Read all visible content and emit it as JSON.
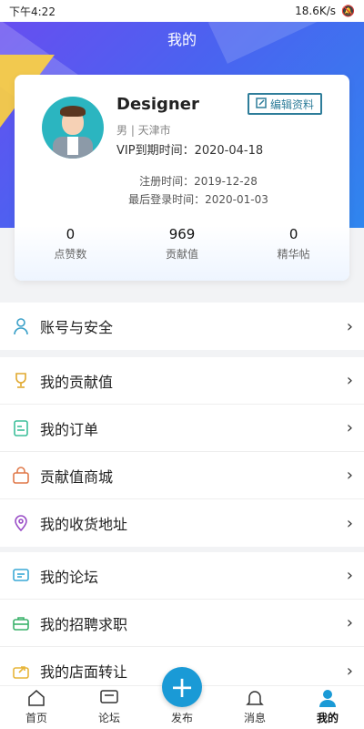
{
  "status": {
    "time": "下午4:22",
    "speed": "18.6K/s"
  },
  "page_title": "我的",
  "profile": {
    "name": "Designer",
    "gender_city": "男 | 天津市",
    "vip": "VIP到期时间：2020-04-18",
    "edit_label": "编辑资料",
    "register": "注册时间：2019-12-28",
    "last_login": "最后登录时间：2020-01-03",
    "stats": [
      {
        "value": "0",
        "label": "点赞数"
      },
      {
        "value": "969",
        "label": "贡献值"
      },
      {
        "value": "0",
        "label": "精华帖"
      }
    ]
  },
  "menu_groups": [
    [
      {
        "label": "账号与安全",
        "icon": "user-icon"
      }
    ],
    [
      {
        "label": "我的贡献值",
        "icon": "trophy-icon"
      },
      {
        "label": "我的订单",
        "icon": "order-icon"
      },
      {
        "label": "贡献值商城",
        "icon": "shop-bag-icon"
      },
      {
        "label": "我的收货地址",
        "icon": "location-icon"
      }
    ],
    [
      {
        "label": "我的论坛",
        "icon": "chat-icon"
      },
      {
        "label": "我的招聘求职",
        "icon": "briefcase-icon"
      },
      {
        "label": "我的店面转让",
        "icon": "share-icon"
      }
    ]
  ],
  "bottom_nav": [
    {
      "label": "首页",
      "icon": "home-icon"
    },
    {
      "label": "论坛",
      "icon": "forum-icon"
    },
    {
      "label": "发布",
      "icon": "plus-icon"
    },
    {
      "label": "消息",
      "icon": "bell-icon"
    },
    {
      "label": "我的",
      "icon": "profile-icon"
    }
  ],
  "colors": {
    "accent": "#1a9ad6",
    "header": "#4a63f0"
  }
}
